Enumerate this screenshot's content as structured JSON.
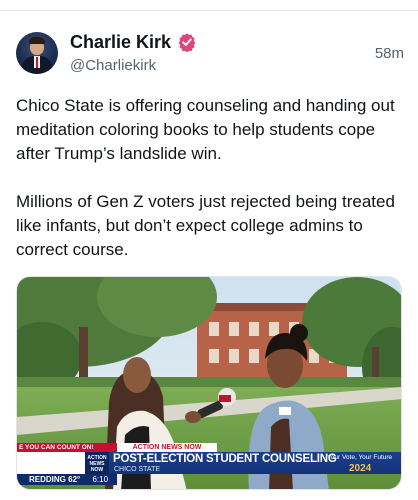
{
  "author": {
    "name": "Charlie Kirk",
    "handle": "@Charliekirk",
    "verified": true,
    "verified_color": "#e0457b"
  },
  "timestamp": "58m",
  "tweet": {
    "paragraph_1": "Chico State is offering counseling and handing out meditation coloring books to help students cope after Trump’s landslide win.",
    "paragraph_2": "Millions of Gen Z voters just rejected being treated like infants, but don’t expect college admins to correct course."
  },
  "media": {
    "banner_red_text": "E YOU CAN COUNT ON!",
    "banner_label": "ACTION NEWS NOW",
    "logo_text": "ACTION NEWS NOW",
    "headline": "POST-ELECTION STUDENT COUNSELING",
    "subheadline": "CHICO STATE",
    "slogan": "Your Vote, Your Future",
    "year": "2024",
    "weather_city": "REDDING",
    "weather_temp": "62°",
    "clock": "6:10",
    "colors": {
      "banner_blue": "#1b3f8f",
      "banner_red": "#c8102e",
      "year_gold": "#f4c542"
    }
  }
}
